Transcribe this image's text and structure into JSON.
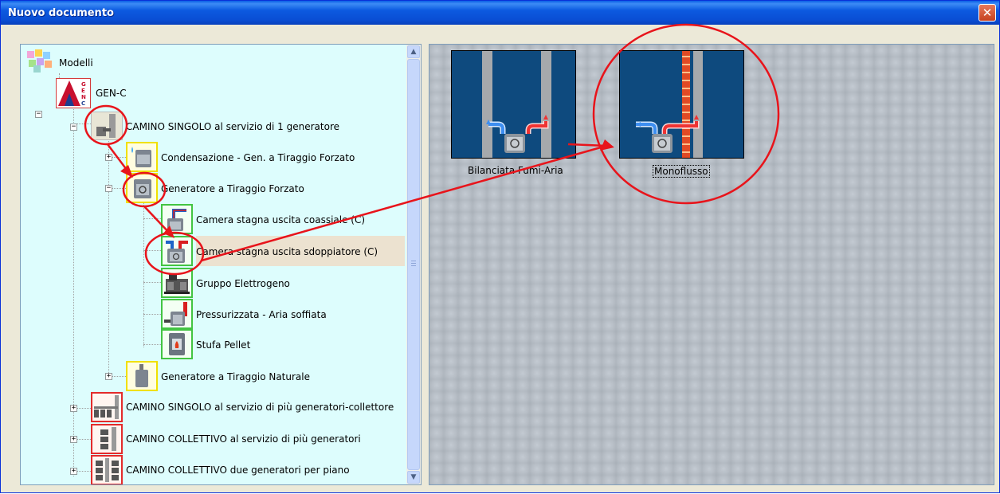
{
  "window": {
    "title": "Nuovo documento"
  },
  "tree": {
    "root": {
      "label": "Modelli"
    },
    "gen_c": {
      "label": "GEN-C",
      "logo_text": "GENC"
    },
    "camino_singolo_1": {
      "label": "CAMINO  SINGOLO al servizio di 1 generatore"
    },
    "condensazione": {
      "label": "Condensazione - Gen. a Tiraggio Forzato"
    },
    "generatore_forzato": {
      "label": "Generatore a Tiraggio Forzato"
    },
    "camera_coassiale": {
      "label": "Camera stagna uscita coassiale (C)"
    },
    "camera_sdoppiatore": {
      "label": "Camera stagna uscita sdoppiatore (C)"
    },
    "gruppo_elettrogeno": {
      "label": "Gruppo Elettrogeno"
    },
    "pressurizzata": {
      "label": "Pressurizzata - Aria soffiata"
    },
    "stufa_pellet": {
      "label": "Stufa Pellet"
    },
    "generatore_naturale": {
      "label": "Generatore a Tiraggio Naturale"
    },
    "camino_singolo_collettore": {
      "label": "CAMINO  SINGOLO al servizio di più generatori-collettore"
    },
    "camino_collettivo": {
      "label": "CAMINO COLLETTIVO al servizio di più generatori"
    },
    "camino_collettivo_due": {
      "label": "CAMINO COLLETTIVO due generatori per piano"
    }
  },
  "gallery": {
    "items": [
      {
        "label": "Bilanciata Fumi-Aria"
      },
      {
        "label": "Monoflusso"
      }
    ]
  },
  "colors": {
    "annotation": "#e8141b",
    "selection": "#ece2d0",
    "tree_bg": "#ddfdfd"
  }
}
